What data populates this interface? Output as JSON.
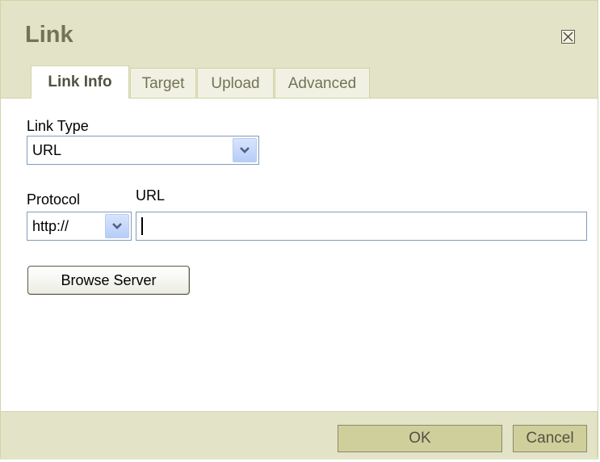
{
  "dialog": {
    "title": "Link",
    "close_icon": "close-box-icon"
  },
  "tabs": [
    {
      "label": "Link Info",
      "active": true
    },
    {
      "label": "Target",
      "active": false
    },
    {
      "label": "Upload",
      "active": false
    },
    {
      "label": "Advanced",
      "active": false
    }
  ],
  "form": {
    "link_type_label": "Link Type",
    "link_type_value": "URL",
    "protocol_label": "Protocol",
    "protocol_value": "http://",
    "url_label": "URL",
    "url_value": "",
    "browse_label": "Browse Server"
  },
  "footer": {
    "ok_label": "OK",
    "cancel_label": "Cancel"
  },
  "colors": {
    "chrome": "#e3e3c7",
    "title_text": "#737357",
    "button": "#cfcf9c",
    "border": "#d3d3a8"
  }
}
